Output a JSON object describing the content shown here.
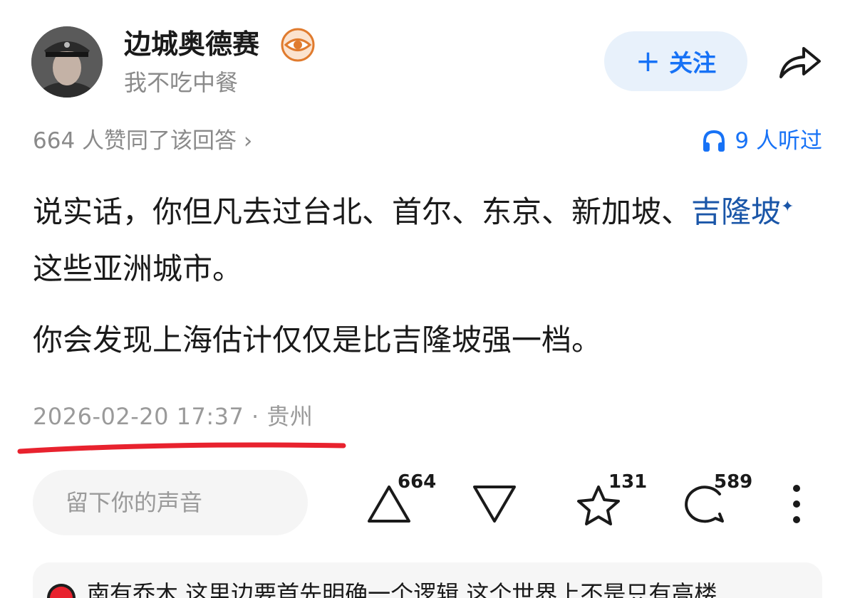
{
  "author": {
    "name": "边城奥德赛",
    "bio": "我不吃中餐",
    "badge_icon": "eye-badge-icon"
  },
  "follow": {
    "plus": "+",
    "label": "关注"
  },
  "stats": {
    "agree_text": "664 人赞同了该回答 ›",
    "listen_text": "9 人听过"
  },
  "content": {
    "para1_before": "说实话，你但凡去过台北、首尔、东京、新加坡、",
    "para1_link": "吉隆坡",
    "para1_sparkle": "✦",
    "para1_after": "这些亚洲城市。",
    "para2": "你会发现上海估计仅仅是比吉隆坡强一档。"
  },
  "meta": {
    "text": "2026-02-20 17:37 · 贵州"
  },
  "comment_input": {
    "placeholder": "留下你的声音"
  },
  "actions": {
    "upvote_count": "664",
    "favorite_count": "131",
    "comment_count": "589"
  },
  "preview": {
    "text": "南有乔木 这里边要首先明确一个逻辑 这个世界上不是只有高楼"
  },
  "colors": {
    "accent": "#1772f6",
    "link": "#1a56a8",
    "underline": "#e8222e"
  }
}
